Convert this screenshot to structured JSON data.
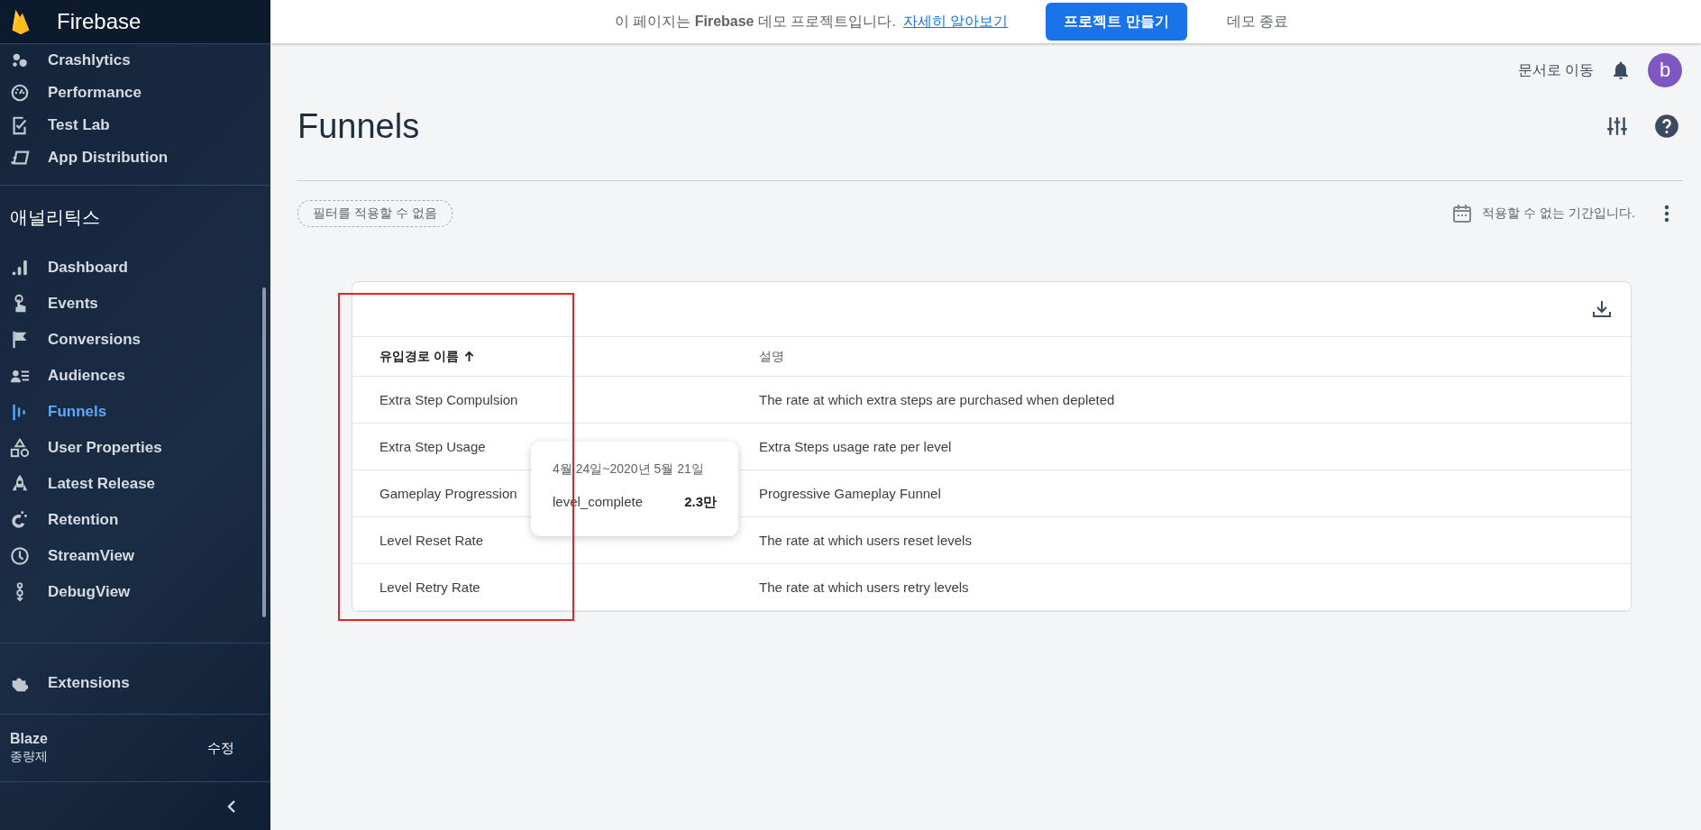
{
  "sidebar": {
    "brand": "Firebase",
    "top_items": [
      {
        "label": "Crashlytics",
        "selected": false
      },
      {
        "label": "Performance",
        "selected": false
      },
      {
        "label": "Test Lab",
        "selected": false
      },
      {
        "label": "App Distribution",
        "selected": false
      }
    ],
    "section_title": "애널리틱스",
    "analytics_items": [
      {
        "label": "Dashboard",
        "selected": false
      },
      {
        "label": "Events",
        "selected": false
      },
      {
        "label": "Conversions",
        "selected": false
      },
      {
        "label": "Audiences",
        "selected": false
      },
      {
        "label": "Funnels",
        "selected": true
      },
      {
        "label": "User Properties",
        "selected": false
      },
      {
        "label": "Latest Release",
        "selected": false
      },
      {
        "label": "Retention",
        "selected": false
      },
      {
        "label": "StreamView",
        "selected": false
      },
      {
        "label": "DebugView",
        "selected": false
      }
    ],
    "extensions": {
      "label": "Extensions"
    },
    "plan": {
      "name": "Blaze",
      "type": "종량제",
      "action": "수정"
    }
  },
  "banner": {
    "text": "이 페이지는 **Firebase** 데모 프로젝트입니다.",
    "link": "자세히 알아보기",
    "primary_button": "프로젝트 만들기",
    "secondary_button": "데모 종료"
  },
  "header": {
    "docs_link": "문서로 이동",
    "avatar": "b"
  },
  "page": {
    "title": "Funnels",
    "filter_chip": "필터를 적용할 수 없음",
    "date_range": "적용할 수 없는 기간입니다."
  },
  "table": {
    "columns": [
      {
        "label": "유입경로 이름",
        "sorted": true
      },
      {
        "label": "설명",
        "sorted": false
      }
    ],
    "rows": [
      {
        "name": "Extra Step Compulsion",
        "description": "The rate at which extra steps are purchased when depleted"
      },
      {
        "name": "Extra Step Usage",
        "description": "Extra Steps usage rate per level"
      },
      {
        "name": "Gameplay Progression",
        "description": "Progressive Gameplay Funnel"
      },
      {
        "name": "Level Reset Rate",
        "description": "The rate at which users reset levels"
      },
      {
        "name": "Level Retry Rate",
        "description": "The rate at which users retry levels"
      }
    ]
  },
  "tooltip": {
    "date": "4월 24일~2020년 5월 21일",
    "metric": "level_complete",
    "value": "2.3만"
  }
}
